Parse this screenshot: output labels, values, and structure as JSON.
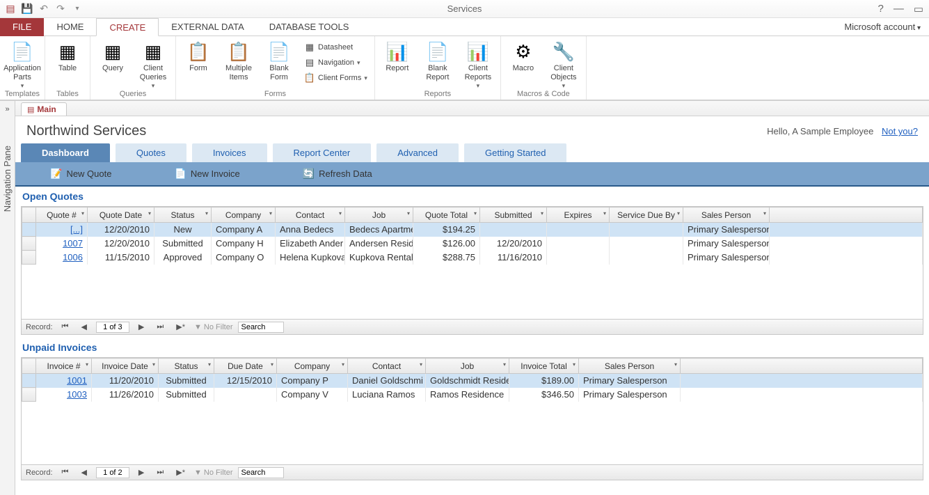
{
  "app": {
    "title": "Services",
    "account": "Microsoft account"
  },
  "tabs": {
    "file": "FILE",
    "home": "HOME",
    "create": "CREATE",
    "external": "EXTERNAL DATA",
    "dbtools": "DATABASE TOOLS"
  },
  "ribbon": {
    "templates": {
      "appParts": "Application\nParts",
      "label": "Templates"
    },
    "tables": {
      "table": "Table",
      "label": "Tables"
    },
    "queries": {
      "query": "Query",
      "clientQueries": "Client\nQueries",
      "label": "Queries"
    },
    "forms": {
      "form": "Form",
      "multiple": "Multiple\nItems",
      "blank": "Blank\nForm",
      "datasheet": "Datasheet",
      "navigation": "Navigation",
      "clientForms": "Client Forms",
      "label": "Forms"
    },
    "reports": {
      "report": "Report",
      "blank": "Blank\nReport",
      "clientReports": "Client\nReports",
      "label": "Reports"
    },
    "macros": {
      "macro": "Macro",
      "clientObjects": "Client\nObjects",
      "label": "Macros & Code"
    }
  },
  "navPane": {
    "label": "Navigation Pane"
  },
  "docTab": "Main",
  "form": {
    "title": "Northwind Services",
    "greeting": "Hello, A Sample Employee",
    "notyou": "Not you?",
    "tabs": [
      "Dashboard",
      "Quotes",
      "Invoices",
      "Report Center",
      "Advanced",
      "Getting Started"
    ],
    "toolbar": {
      "newQuote": "New Quote",
      "newInvoice": "New Invoice",
      "refresh": "Refresh Data"
    }
  },
  "quotes": {
    "title": "Open Quotes",
    "cols": [
      "Quote #",
      "Quote Date",
      "Status",
      "Company",
      "Contact",
      "Job",
      "Quote Total",
      "Submitted",
      "Expires",
      "Service Due By",
      "Sales Person"
    ],
    "rows": [
      {
        "q": "[...]",
        "date": "12/20/2010",
        "status": "New",
        "company": "Company A",
        "contact": "Anna Bedecs",
        "job": "Bedecs Apartme",
        "total": "$194.25",
        "submitted": "",
        "expires": "",
        "due": "",
        "sales": "Primary Salesperson",
        "selected": true
      },
      {
        "q": "1007",
        "date": "12/20/2010",
        "status": "Submitted",
        "company": "Company H",
        "contact": "Elizabeth Ander",
        "job": "Andersen Resid",
        "total": "$126.00",
        "submitted": "12/20/2010",
        "expires": "",
        "due": "",
        "sales": "Primary Salesperson"
      },
      {
        "q": "1006",
        "date": "11/15/2010",
        "status": "Approved",
        "company": "Company O",
        "contact": "Helena Kupkova",
        "job": "Kupkova Rental",
        "total": "$288.75",
        "submitted": "11/16/2010",
        "expires": "",
        "due": "",
        "sales": "Primary Salesperson"
      }
    ],
    "record": {
      "label": "Record:",
      "pos": "1 of 3",
      "nofilter": "No Filter",
      "search": "Search"
    }
  },
  "invoices": {
    "title": "Unpaid Invoices",
    "cols": [
      "Invoice #",
      "Invoice Date",
      "Status",
      "Due Date",
      "Company",
      "Contact",
      "Job",
      "Invoice Total",
      "Sales Person"
    ],
    "rows": [
      {
        "n": "1001",
        "date": "11/20/2010",
        "status": "Submitted",
        "due": "12/15/2010",
        "company": "Company P",
        "contact": "Daniel Goldschmi",
        "job": "Goldschmidt Reside",
        "total": "$189.00",
        "sales": "Primary Salesperson",
        "selected": true
      },
      {
        "n": "1003",
        "date": "11/26/2010",
        "status": "Submitted",
        "due": "",
        "company": "Company V",
        "contact": "Luciana Ramos",
        "job": "Ramos Residence",
        "total": "$346.50",
        "sales": "Primary Salesperson"
      }
    ],
    "record": {
      "label": "Record:",
      "pos": "1 of 2",
      "nofilter": "No Filter",
      "search": "Search"
    }
  }
}
